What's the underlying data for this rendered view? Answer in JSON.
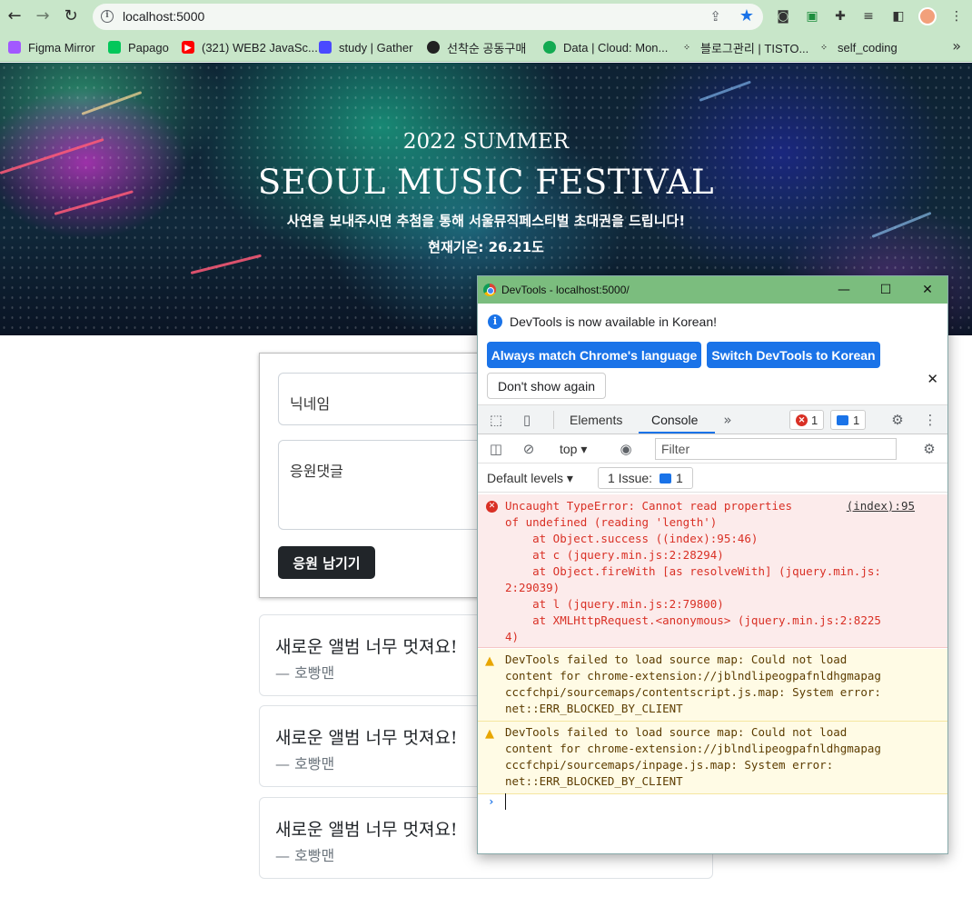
{
  "browser": {
    "url": "localhost:5000",
    "bookmarks": [
      {
        "label": "Figma Mirror",
        "color": "#a259ff"
      },
      {
        "label": "Papago",
        "color": "#03c75a"
      },
      {
        "label": "(321) WEB2 JavaSc...",
        "color": "#ff0000"
      },
      {
        "label": "study | Gather",
        "color": "#4a4aff"
      },
      {
        "label": "선착순 공동구매",
        "color": "#222222"
      },
      {
        "label": "Data | Cloud: Mon...",
        "color": "#13aa52"
      },
      {
        "label": "블로그관리 | TISTO...",
        "color": "#333333"
      },
      {
        "label": "self_coding",
        "color": "#333333"
      }
    ]
  },
  "page": {
    "hero_sub": "2022 SUMMER",
    "hero_title": "SEOUL MUSIC FESTIVAL",
    "hero_desc": "사연을 보내주시면 추첨을 통해 서울뮤직페스티벌 초대권을 드립니다!",
    "hero_temp": "현재기온: 26.21도",
    "nickname_placeholder": "닉네임",
    "comment_placeholder": "응원댓글",
    "submit_label": "응원 남기기",
    "comments": [
      {
        "text": "새로운 앨범 너무 멋져요!",
        "name": "— 호빵맨"
      },
      {
        "text": "새로운 앨범 너무 멋져요!",
        "name": "— 호빵맨"
      },
      {
        "text": "새로운 앨범 너무 멋져요!",
        "name": "— 호빵맨"
      }
    ]
  },
  "devtools": {
    "window_title": "DevTools - localhost:5000/",
    "info_message": "DevTools is now available in Korean!",
    "btn_match": "Always match Chrome's language",
    "btn_switch": "Switch DevTools to Korean",
    "btn_dont_show": "Don't show again",
    "tab_elements": "Elements",
    "tab_console": "Console",
    "error_count": "1",
    "message_count": "1",
    "context": "top",
    "filter_placeholder": "Filter",
    "levels": "Default levels",
    "issues": "1 Issue:",
    "issues_count": "1",
    "error": {
      "source": "(index):95",
      "lines": [
        "Uncaught TypeError: Cannot read properties",
        "of undefined (reading 'length')",
        "    at Object.success ((index):95:46)",
        "    at c (jquery.min.js:2:28294)",
        "    at Object.fireWith [as resolveWith] (jquery.min.js:",
        "2:29039)",
        "    at l (jquery.min.js:2:79800)",
        "    at XMLHttpRequest.<anonymous> (jquery.min.js:2:8225",
        "4)"
      ]
    },
    "warnings": [
      {
        "lines": [
          "DevTools failed to load source map: Could not load",
          "content for chrome-extension://jblndlipeogpafnldhgmapag",
          "cccfchpi/sourcemaps/contentscript.js.map: System error:",
          "net::ERR_BLOCKED_BY_CLIENT"
        ]
      },
      {
        "lines": [
          "DevTools failed to load source map: Could not load",
          "content for chrome-extension://jblndlipeogpafnldhgmapag",
          "cccfchpi/sourcemaps/inpage.js.map: System error:",
          "net::ERR_BLOCKED_BY_CLIENT"
        ]
      }
    ]
  }
}
